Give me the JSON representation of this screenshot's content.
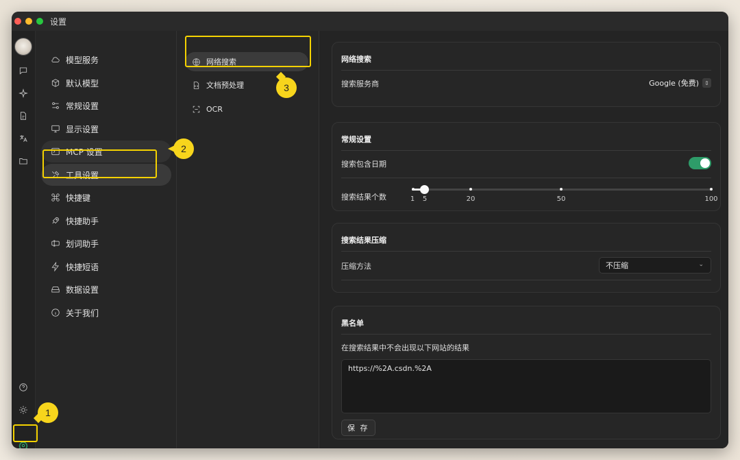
{
  "window": {
    "title": "设置"
  },
  "menu": {
    "items": [
      {
        "label": "模型服务",
        "icon": "cloud-icon"
      },
      {
        "label": "默认模型",
        "icon": "cube-icon"
      },
      {
        "label": "常规设置",
        "icon": "sliders-icon"
      },
      {
        "label": "显示设置",
        "icon": "monitor-icon"
      },
      {
        "label": "MCP 设置",
        "icon": "terminal-icon"
      },
      {
        "label": "工具设置",
        "icon": "tools-icon"
      },
      {
        "label": "快捷键",
        "icon": "command-icon"
      },
      {
        "label": "快捷助手",
        "icon": "rocket-icon"
      },
      {
        "label": "划词助手",
        "icon": "text-cursor-icon"
      },
      {
        "label": "快捷短语",
        "icon": "zap-icon"
      },
      {
        "label": "数据设置",
        "icon": "hard-drive-icon"
      },
      {
        "label": "关于我们",
        "icon": "info-icon"
      }
    ],
    "active": "工具设置"
  },
  "submenu": {
    "items": [
      {
        "label": "网络搜索",
        "icon": "globe-icon"
      },
      {
        "label": "文档预处理",
        "icon": "file-code-icon"
      },
      {
        "label": "OCR",
        "icon": "scan-icon"
      }
    ],
    "active": "网络搜索"
  },
  "web_search": {
    "title": "网络搜索",
    "provider_label": "搜索服务商",
    "provider_value": "Google (免费)"
  },
  "general": {
    "title": "常规设置",
    "include_date_label": "搜索包含日期",
    "include_date": true,
    "result_count_label": "搜索结果个数",
    "result_count": 5,
    "slider_min": 1,
    "slider_max": 100,
    "slider_marks": [
      "1",
      "5",
      "20",
      "50",
      "100"
    ]
  },
  "compression": {
    "title": "搜索结果压缩",
    "method_label": "压缩方法",
    "method_value": "不压缩"
  },
  "blacklist": {
    "title": "黑名单",
    "description": "在搜索结果中不会出现以下网站的结果",
    "content": "https://%2A.csdn.%2A",
    "save_label": "保 存"
  },
  "annotations": [
    "1",
    "2",
    "3"
  ],
  "colors": {
    "accent": "#2e9c69",
    "highlight": "#f5d200"
  }
}
